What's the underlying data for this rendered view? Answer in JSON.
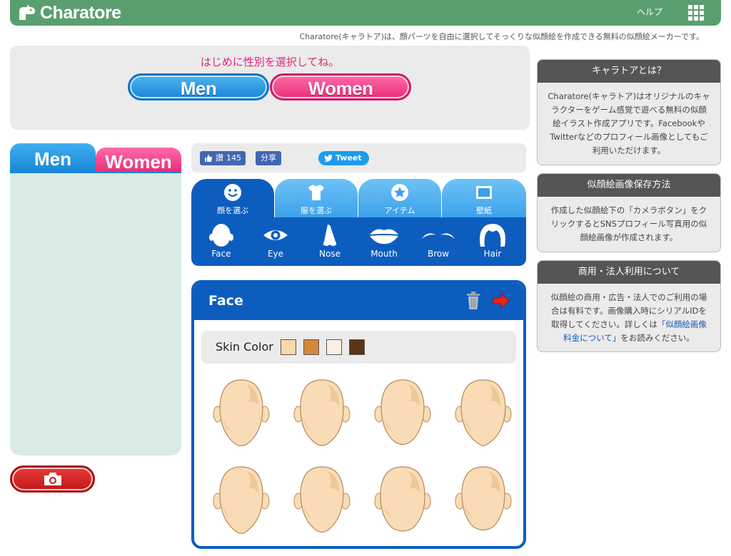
{
  "header": {
    "logo_text": "Charatore",
    "help_label": "ヘルプ"
  },
  "tagline": "Charatore(キャラトア)は、顔パーツを自由に選択してそっくりな似顔絵を作成できる無料の似顔絵メーカーです。",
  "gender_select": {
    "prompt": "はじめに性別を選択してね。",
    "men_label": "Men",
    "women_label": "Women"
  },
  "preview_tabs": {
    "men_label": "Men",
    "women_label": "Women"
  },
  "social": {
    "like_label": "讚",
    "like_count": "145",
    "share_label": "分享",
    "tweet_label": "Tweet"
  },
  "category_tabs": [
    {
      "label": "顔を選ぶ",
      "icon": "smiley-face-icon",
      "active": true
    },
    {
      "label": "服を選ぶ",
      "icon": "shirt-icon",
      "active": false
    },
    {
      "label": "アイテム",
      "icon": "star-badge-icon",
      "active": false
    },
    {
      "label": "壁紙",
      "icon": "frame-icon",
      "active": false
    }
  ],
  "parts": [
    {
      "label": "Face",
      "icon": "face-icon"
    },
    {
      "label": "Eye",
      "icon": "eye-icon"
    },
    {
      "label": "Nose",
      "icon": "nose-icon"
    },
    {
      "label": "Mouth",
      "icon": "mouth-icon"
    },
    {
      "label": "Brow",
      "icon": "brow-icon"
    },
    {
      "label": "Hair",
      "icon": "hair-icon"
    }
  ],
  "face_panel": {
    "title": "Face",
    "skin_label": "Skin Color",
    "skin_colors": [
      "#fbd9ad",
      "#d4893c",
      "#fbefe4",
      "#5c3416"
    ],
    "face_fill": "#f9dcb5",
    "face_shade": "#edc898",
    "face_count": 8
  },
  "info_panels": [
    {
      "title": "キャラトアとは？",
      "lines": [
        "Charatore(キャラトア)はオリジナルのキャ",
        "ラクターをゲーム感覚で遊べる無料の似顔",
        "絵イラスト作成アプリです。Facebookや",
        "Twitterなどのプロフィール画像としてもご",
        "利用いただけます。"
      ]
    },
    {
      "title": "似顔絵画像保存方法",
      "lines": [
        "作成した似顔絵下の「カメラボタン」をク",
        "リックするとSNSプロフィール写真用の似",
        "顔絵画像が作成されます。"
      ]
    },
    {
      "title": "商用・法人利用について",
      "lines": [
        "似顔絵の商用・広告・法人でのご利用の場",
        "合は有料です。画像購入時にシリアルIDを",
        "取得してください。詳しくは"
      ],
      "link_1": "「似顔絵画像",
      "link_2": "料金について」",
      "tail": "をお読みください。"
    }
  ],
  "colors": {
    "header_green": "#5a9e6f",
    "men_blue": "#1a86d6",
    "women_pink": "#e92e78",
    "panel_blue": "#0d5dbf",
    "camera_red": "#c21717"
  }
}
